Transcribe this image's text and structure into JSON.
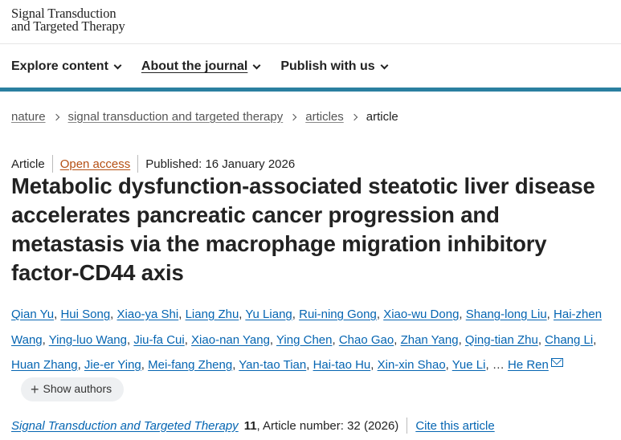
{
  "logo": {
    "line1": "Signal Transduction",
    "line2": "and Targeted Therapy"
  },
  "nav": [
    {
      "label": "Explore content"
    },
    {
      "label": "About the journal"
    },
    {
      "label": "Publish with us"
    }
  ],
  "breadcrumbs": {
    "items": [
      "nature",
      "signal transduction and targeted therapy",
      "articles"
    ],
    "current": "article"
  },
  "meta": {
    "type": "Article",
    "access": "Open access",
    "published": "Published: 16 January 2026"
  },
  "title": "Metabolic dysfunction-associated steatotic liver disease accelerates pancreatic cancer progression and metastasis via the macrophage migration inhibitory factor-CD44 axis",
  "authors": [
    "Qian Yu",
    "Hui Song",
    "Xiao-ya Shi",
    "Liang Zhu",
    "Yu Liang",
    "Rui-ning Gong",
    "Xiao-wu Dong",
    "Shang-long Liu",
    "Hai-zhen Wang",
    "Ying-luo Wang",
    "Jiu-fa Cui",
    "Xiao-nan Yang",
    "Ying Chen",
    "Chao Gao",
    "Zhan Yang",
    "Qing-tian Zhu",
    "Chang Li",
    "Huan Zhang",
    "Jie-er Ying",
    "Mei-fang Zheng",
    "Yan-tao Tian",
    "Hai-tao Hu",
    "Xin-xin Shao",
    "Yue Li"
  ],
  "authors_ellipsis": "…",
  "last_author": "He Ren",
  "show_authors": "Show authors",
  "citation": {
    "journal": "Signal Transduction and Targeted Therapy",
    "volume": "11",
    "article_number": ", Article number: 32 (2026)",
    "cite_label": "Cite this article"
  },
  "colors": {
    "link": "#0565b2",
    "open_access": "#b54f13",
    "nav_bar": "#2a7fa0"
  }
}
